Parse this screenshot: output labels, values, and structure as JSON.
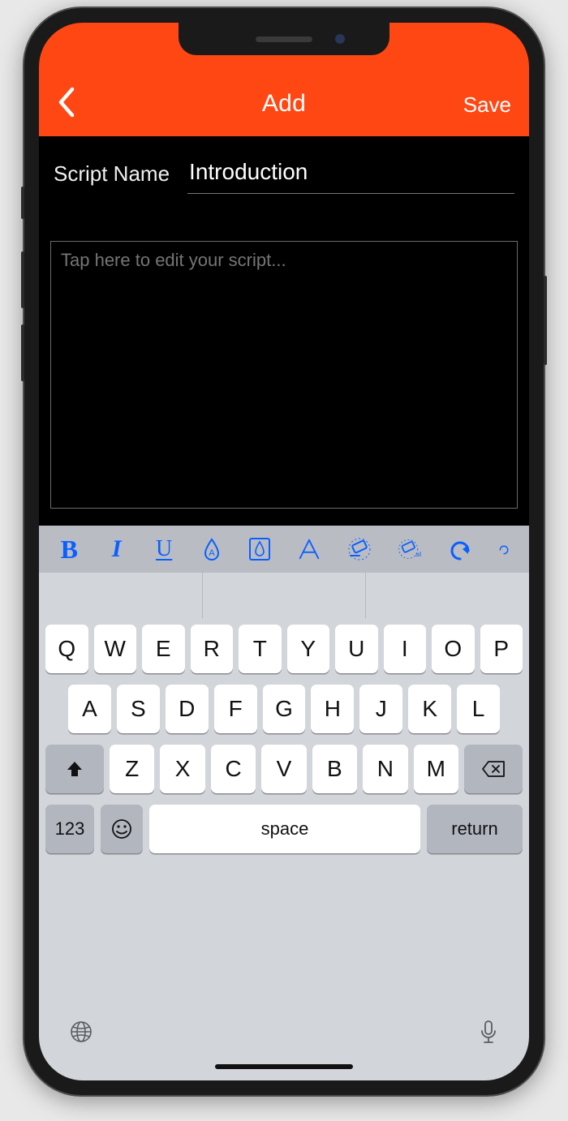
{
  "colors": {
    "accent": "#ff4713",
    "toolbar_icon": "#0a5fff"
  },
  "header": {
    "title": "Add",
    "save_label": "Save"
  },
  "form": {
    "name_label": "Script Name",
    "name_value": "Introduction",
    "script_placeholder": "Tap here to edit your script...",
    "script_value": ""
  },
  "toolbar_items": [
    {
      "name": "bold-icon",
      "glyph": "B"
    },
    {
      "name": "italic-icon",
      "glyph": "I"
    },
    {
      "name": "underline-icon",
      "glyph": "U"
    },
    {
      "name": "text-color-icon",
      "glyph": "drop-outline"
    },
    {
      "name": "highlight-color-icon",
      "glyph": "drop-box"
    },
    {
      "name": "font-icon",
      "glyph": "A-outline"
    },
    {
      "name": "erase-format-icon",
      "glyph": "eraser"
    },
    {
      "name": "erase-all-icon",
      "glyph": "eraser-all"
    },
    {
      "name": "undo-icon",
      "glyph": "undo"
    },
    {
      "name": "redo-icon",
      "glyph": "redo-partial"
    }
  ],
  "keyboard": {
    "row1": [
      "Q",
      "W",
      "E",
      "R",
      "T",
      "Y",
      "U",
      "I",
      "O",
      "P"
    ],
    "row2": [
      "A",
      "S",
      "D",
      "F",
      "G",
      "H",
      "J",
      "K",
      "L"
    ],
    "row3": [
      "Z",
      "X",
      "C",
      "V",
      "B",
      "N",
      "M"
    ],
    "numbers_label": "123",
    "space_label": "space",
    "return_label": "return"
  }
}
